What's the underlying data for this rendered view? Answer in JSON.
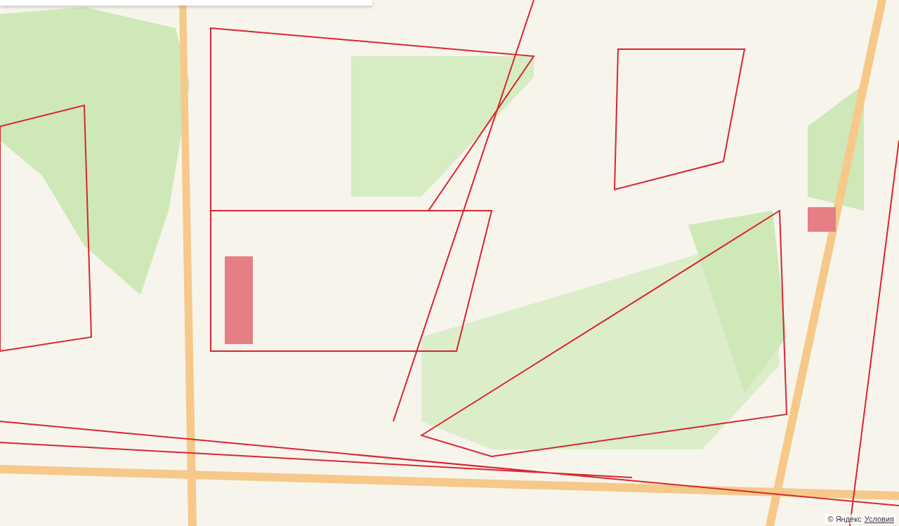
{
  "attribution": {
    "copyright": "© Яндекс",
    "terms": "Условия"
  }
}
